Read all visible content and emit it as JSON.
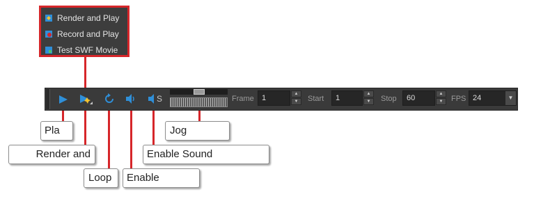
{
  "menu": {
    "items": [
      {
        "label": "Render and Play",
        "icon": "render-play-icon"
      },
      {
        "label": "Record and Play",
        "icon": "record-play-icon"
      },
      {
        "label": "Test SWF Movie",
        "icon": "test-swf-icon"
      }
    ]
  },
  "toolbar": {
    "frame_label": "Frame",
    "frame_value": "1",
    "start_label": "Start",
    "start_value": "1",
    "stop_label": "Stop",
    "stop_value": "60",
    "fps_label": "FPS",
    "fps_value": "24",
    "sound_icon_letter": "S"
  },
  "callouts": {
    "play": "Pla",
    "render": "Render and",
    "loop": "Loop",
    "enable": "Enable",
    "enable_sound": "Enable Sound",
    "jog": "Jog"
  },
  "colors": {
    "accent_red": "#d6262a",
    "icon_blue": "#2f8fd8",
    "toolbar_bg": "#3a3a3a"
  }
}
